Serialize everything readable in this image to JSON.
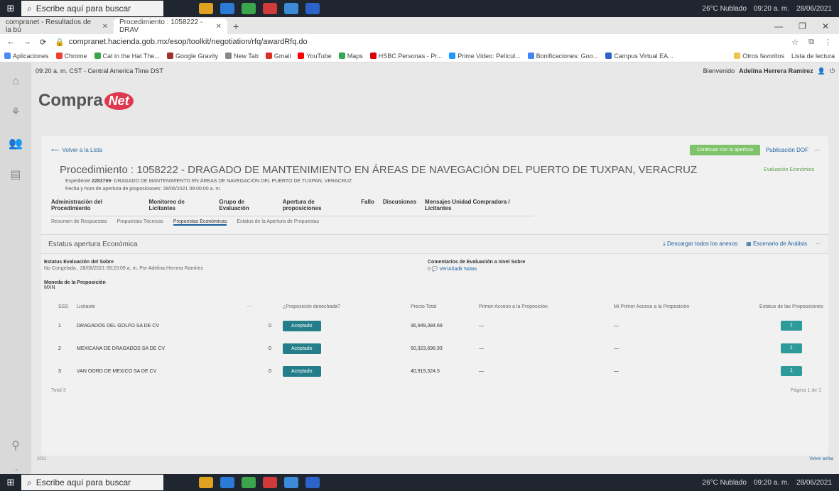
{
  "taskbar": {
    "search_text": "Escribe aquí para buscar",
    "weather": "26°C Nublado",
    "time": "09:20 a. m.",
    "date": "28/06/2021"
  },
  "browser": {
    "tabs": [
      {
        "label": "compranet - Resultados de la bú"
      },
      {
        "label": "Procedimiento : 1058222 - DRAV"
      }
    ],
    "url": "compranet.hacienda.gob.mx/esop/toolkit/negotiation/rfq/awardRfq.do",
    "bookmarks": [
      "Aplicaciones",
      "Chrome",
      "Cat in the Hat The...",
      "Google Gravity",
      "New Tab",
      "Gmail",
      "YouTube",
      "Maps",
      "HSBC Personas - Pr...",
      "Prime Video: Películ...",
      "Bonificaciones: Goo...",
      "Campus Virtual EA..."
    ],
    "bookmarks_right": [
      "Otros favoritos",
      "Lista de lectura"
    ]
  },
  "app": {
    "clock_text": "09:20 a. m. CST - Central America Time DST",
    "welcome_prefix": "Bienvenido",
    "user_name": "Adelina Herrera Ramírez",
    "logo_compra": "Compra",
    "logo_net": "Net"
  },
  "main": {
    "back_link": "Volver a la Lista",
    "btn_continue": "Continuar con la apertura",
    "link_dof": "Publicación DOF",
    "more": "···",
    "title": "Procedimiento : 1058222 - DRAGADO DE MANTENIMIENTO EN ÁREAS DE NAVEGACIÓN DEL PUERTO DE TUXPAN, VERACRUZ",
    "eval_label": "Evaluación Económica",
    "expediente_label": "Expediente",
    "expediente_value": "2283769",
    "expediente_desc": "- DRAGADO DE MANTENIMIENTO EN ÁREAS DE NAVEGACIÓN DEL PUERTO DE TUXPAN, VERACRUZ",
    "fecha_text": "Fecha y hora de apertura de proposiciones: 28/06/2021 09:00:00 a. m.",
    "tabs1": [
      "Administración del Procedimiento",
      "Monitoreo de Licitantes",
      "Grupo de Evaluación",
      "Apertura de proposiciones",
      "Fallo",
      "Discusiones",
      "Mensajes Unidad Compradora / Licitantes"
    ],
    "tabs2": [
      "Resumen de Respuestas",
      "Propuestas Técnicas",
      "Propuestas Económicas",
      "Estatus de la Apertura de Propuestas"
    ],
    "section_title": "Estatus apertura Económica",
    "download_all": "Descargar todos los anexos",
    "scenario": "Escenario de Análisis",
    "estatus_label": "Estatus Evaluación del Sobre",
    "estatus_value": "No Congelada , 28/06/2021 09:20:09 a. m.  Por Adelina Herrera Ramírez",
    "comentarios_label": "Comentarios de Evaluación a nivel Sobre",
    "comentarios_count": "0",
    "notes_link": "Ver/Añadir Notas",
    "moneda_label": "Moneda de la Proposición",
    "moneda_value": "MXN"
  },
  "table": {
    "headers": {
      "sss": "SSS",
      "licitante": "Licitante",
      "dots": "- -",
      "desechada": "¿Proposición desechada?",
      "precio": "Precio Total",
      "primer_acceso": "Primer Acceso a la Proposición",
      "mi_primer": "Mi Primer Acceso a la Proposición",
      "estatus": "Estatus de las Proposiciones"
    },
    "rows": [
      {
        "num": "1",
        "licitante": "DRAGADOS DEL GOLFO SA DE CV",
        "zero": "0",
        "estado": "Aceptado",
        "precio": "36,949,384.69",
        "pa": "—",
        "mpa": "—",
        "est": "1"
      },
      {
        "num": "2",
        "licitante": "MEXICANA DE DRAGADOS SA DE CV",
        "zero": "0",
        "estado": "Aceptado",
        "precio": "50,323,696.93",
        "pa": "—",
        "mpa": "—",
        "est": "1"
      },
      {
        "num": "3",
        "licitante": "VAN OORD DE MEXICO SA DE CV",
        "zero": "0",
        "estado": "Aceptado",
        "precio": "40,919,324.5",
        "pa": "—",
        "mpa": "—",
        "est": "1"
      }
    ],
    "total": "Total 3",
    "page": "Página 1 de 1"
  },
  "footer": {
    "year": "2021",
    "volver": "Volver arriba"
  },
  "colors": {
    "accent_green": "#7fc36a",
    "accept_teal": "#237e8a",
    "link_blue": "#1b5e9e",
    "logo_red": "#e0384f"
  }
}
